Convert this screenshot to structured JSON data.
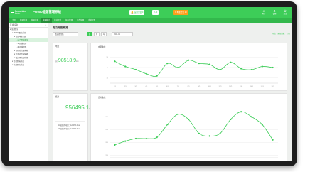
{
  "app": {
    "brand_name": "Schneider",
    "brand_sub": "Electric",
    "title": "PO500能源管理系统",
    "alarms": [
      {
        "icon": "bell-icon",
        "glyph": "🔔",
        "label": "设备告警 0",
        "style": "g"
      },
      {
        "icon": "warning-icon",
        "glyph": "⚠",
        "label": "0",
        "style": "g"
      },
      {
        "icon": "bolt-icon",
        "glyph": "ϟ",
        "label": "电能告警 10",
        "style": "o"
      }
    ],
    "top_icons": [
      {
        "icon": "user-icon",
        "glyph": "☺",
        "label": "用户"
      },
      {
        "icon": "settings-icon",
        "glyph": "⚙",
        "label": "设置"
      },
      {
        "icon": "exit-icon",
        "glyph": "⏻",
        "label": "退出"
      }
    ]
  },
  "tabs": [
    "主页",
    "能耗监测",
    "能耗分析",
    "能耗统计",
    "能效评估",
    "报表管理",
    "告警管理",
    "系统设置"
  ],
  "active_tab": 3,
  "sidebar": {
    "search_label": "区域/设备",
    "collapse_glyph": "≡",
    "items": [
      {
        "label": "全部区域",
        "level": 0
      },
      {
        "label": "PO500配电系统",
        "level": 1
      },
      {
        "label": "总配电柜回路",
        "level": 2
      },
      {
        "label": "电力用能概览",
        "level": 3,
        "selected": true
      },
      {
        "label": "1#进线回路",
        "level": 3
      },
      {
        "label": "2#进线回路",
        "level": 3
      },
      {
        "label": "照明动力配电箱",
        "level": 2
      },
      {
        "label": "空调动力配电箱",
        "level": 2
      },
      {
        "label": "插座用电配电箱",
        "level": 2
      },
      {
        "label": "冷站配电系统",
        "level": 1
      },
      {
        "label": "热站配电系统",
        "level": 1
      }
    ]
  },
  "page": {
    "title": "电力用能概览",
    "select_placeholder": "请选择回路",
    "period_buttons": [
      "日",
      "月",
      "年"
    ],
    "active_period": 0,
    "date_value": "2021-09",
    "actions": [
      "导出",
      "刷新数据",
      "打印"
    ]
  },
  "stats": {
    "card1_title": "电量",
    "card1_prefix": "总",
    "card1_value": "98518.9",
    "card1_unit": "kw",
    "card2_title": "费用",
    "card2_value": "956495.1",
    "card2_unit": "kw",
    "details": [
      "1#进线用电量：123456.4 kw",
      "2#进线用电量：123456.7 kw"
    ]
  },
  "colors": {
    "brand": "#3dcd58",
    "alert": "#ff9f1a",
    "line": "#3dcd58"
  },
  "chart_data": [
    {
      "type": "line",
      "title": "电量曲线",
      "x": [
        "1/1",
        "2/1",
        "3/1",
        "4/1",
        "5/1",
        "6/1",
        "7/1",
        "8/1",
        "9/1",
        "10/1",
        "11/1",
        "12/1",
        "13/1",
        "14/1",
        "15/1",
        "16/1"
      ],
      "series": [
        {
          "values": [
            46,
            41,
            38,
            34,
            32,
            44,
            40,
            47,
            44,
            43,
            38,
            45,
            39,
            38,
            41,
            40
          ]
        }
      ],
      "yticks": [
        30,
        40,
        50
      ],
      "ylim": [
        25,
        55
      ],
      "grid": true
    },
    {
      "type": "line",
      "title": "费用曲线",
      "x": [
        "1/1",
        "2/1",
        "3/1",
        "4/1",
        "5/1",
        "6/1",
        "7/1",
        "8/1",
        "9/1",
        "10/1",
        "11/1",
        "12/1",
        "13/1",
        "14/1",
        "15/1",
        "16/1"
      ],
      "series": [
        {
          "values": [
            190,
            205,
            215,
            215,
            220,
            270,
            310,
            290,
            235,
            225,
            235,
            290,
            320,
            300,
            270,
            210
          ]
        }
      ],
      "yticks": [
        150,
        200,
        250,
        300
      ],
      "ylim": [
        140,
        340
      ],
      "grid": true
    }
  ]
}
